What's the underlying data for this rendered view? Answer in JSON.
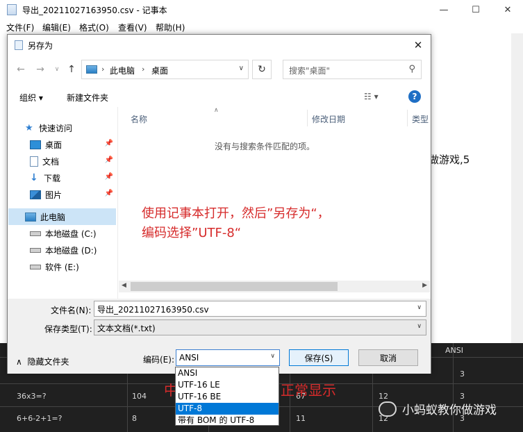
{
  "notepad": {
    "title": "导出_20211027163950.csv - 记事本",
    "menus": [
      "文件(F)",
      "编辑(E)",
      "格式(O)",
      "查看(V)",
      "帮助(H)"
    ],
    "visible_fragment": "做游戏,5"
  },
  "dialog": {
    "title": "另存为",
    "breadcrumb": [
      "此电脑",
      "桌面"
    ],
    "search_placeholder": "搜索\"桌面\"",
    "organize_label": "组织 ▾",
    "new_folder_label": "新建文件夹",
    "nav_items": [
      {
        "label": "快速访问",
        "icon": "star-icon",
        "pinned": false
      },
      {
        "label": "桌面",
        "icon": "desktop-icon",
        "pinned": true
      },
      {
        "label": "文档",
        "icon": "documents-icon",
        "pinned": true
      },
      {
        "label": "下载",
        "icon": "download-icon",
        "pinned": true
      },
      {
        "label": "图片",
        "icon": "pictures-icon",
        "pinned": true
      },
      {
        "label": "此电脑",
        "icon": "computer-icon",
        "pinned": false
      },
      {
        "label": "本地磁盘 (C:)",
        "icon": "drive-icon",
        "pinned": false
      },
      {
        "label": "本地磁盘 (D:)",
        "icon": "drive-icon",
        "pinned": false
      },
      {
        "label": "软件 (E:)",
        "icon": "drive-icon",
        "pinned": false
      }
    ],
    "columns": [
      "名称",
      "修改日期",
      "类型"
    ],
    "empty_message": "没有与搜索条件匹配的项。",
    "filename_label": "文件名(N):",
    "filename_value": "导出_20211027163950.csv",
    "filetype_label": "保存类型(T):",
    "filetype_value": "文本文档(*.txt)",
    "hide_folders_label": "隐藏文件夹",
    "encoding_label": "编码(E):",
    "encoding_value": "ANSI",
    "save_label": "保存(S)",
    "cancel_label": "取消",
    "encoding_options": [
      "ANSI",
      "UTF-16 LE",
      "UTF-16 BE",
      "UTF-8",
      "带有 BOM 的 UTF-8"
    ],
    "encoding_highlighted": "UTF-8"
  },
  "annotation": {
    "line1": "使用记事本打开，然后”另存为“，",
    "line2": "编码选择”UTF-8“"
  },
  "background_table": {
    "header_right": "ANSI",
    "rows": [
      [
        "36x3=?",
        "104",
        "67",
        "12"
      ],
      [
        "6+6-2+1=?",
        "8",
        "11",
        "12"
      ]
    ],
    "row0_right": "3",
    "row1_right": "3",
    "row2_right": "3",
    "red_text": "中"
  },
  "watermark": "小蚂蚁教你做游戏"
}
